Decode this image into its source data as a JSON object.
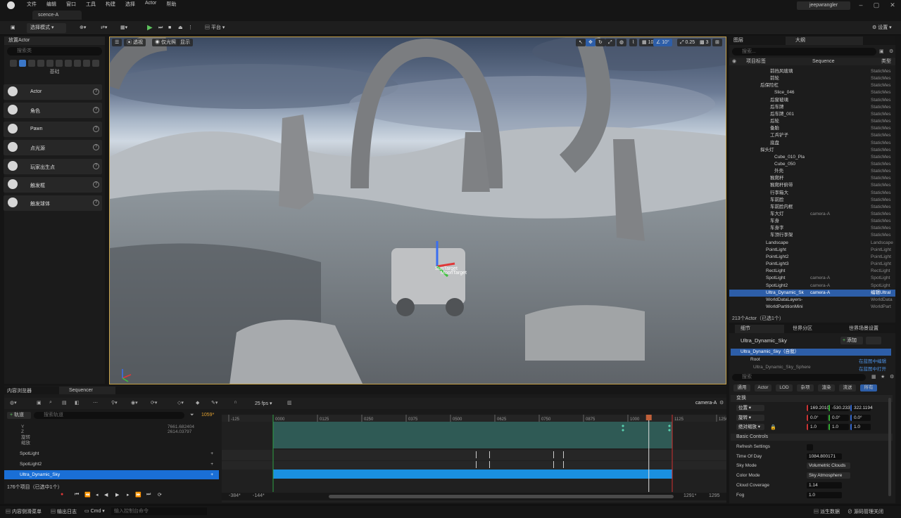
{
  "menu": [
    "文件",
    "编辑",
    "窗口",
    "工具",
    "构建",
    "选择",
    "Actor",
    "帮助"
  ],
  "scene_tab": "scence-A",
  "user": "jeepwrangler",
  "toolbar": {
    "select_mode": "选择模式",
    "platform": "平台",
    "settings": "设置"
  },
  "place": {
    "title": "放置Actor",
    "search_placeholder": "搜索类",
    "category": "基础",
    "items": [
      {
        "label": "Actor"
      },
      {
        "label": "角色"
      },
      {
        "label": "Pawn"
      },
      {
        "label": "点光源"
      },
      {
        "label": "玩家出生点"
      },
      {
        "label": "触发框"
      },
      {
        "label": "触发球体"
      }
    ]
  },
  "viewport": {
    "perspective": "透视",
    "lit": "仅光照",
    "show": "显示",
    "grid": "10",
    "angle": "10°",
    "scale": "0.25",
    "cam": "3",
    "labels": [
      "SunTarget",
      "MoonTarget"
    ]
  },
  "outliner": {
    "tab1": "图层",
    "tab2": "大纲",
    "search_placeholder": "搜索...",
    "col_label": "项目标签",
    "col_seq": "Sequence",
    "col_type": "类型",
    "rows": [
      {
        "name": "前挡风玻璃",
        "seq": "",
        "type": "StaticMes"
      },
      {
        "name": "前轮",
        "seq": "",
        "type": "StaticMes"
      },
      {
        "name": "后保险杠",
        "seq": "",
        "type": "StaticMes"
      },
      {
        "name": "Slice_046",
        "seq": "",
        "type": "StaticMes"
      },
      {
        "name": "后窗玻璃",
        "seq": "",
        "type": "StaticMes"
      },
      {
        "name": "后车牌",
        "seq": "",
        "type": "StaticMes"
      },
      {
        "name": "后车牌_001",
        "seq": "",
        "type": "StaticMes"
      },
      {
        "name": "后轮",
        "seq": "",
        "type": "StaticMes"
      },
      {
        "name": "备胎",
        "seq": "",
        "type": "StaticMes"
      },
      {
        "name": "工兵铲子",
        "seq": "",
        "type": "StaticMes"
      },
      {
        "name": "底盘",
        "seq": "",
        "type": "StaticMes"
      },
      {
        "name": "探头灯",
        "seq": "",
        "type": "StaticMes"
      },
      {
        "name": "Cube_010_Pla",
        "seq": "",
        "type": "StaticMes"
      },
      {
        "name": "Cube_050",
        "seq": "",
        "type": "StaticMes"
      },
      {
        "name": "外壳",
        "seq": "",
        "type": "StaticMes"
      },
      {
        "name": "猴爬杆",
        "seq": "",
        "type": "StaticMes"
      },
      {
        "name": "猴爬杆俯带",
        "seq": "",
        "type": "StaticMes"
      },
      {
        "name": "行李箱大",
        "seq": "",
        "type": "StaticMes"
      },
      {
        "name": "车前脸",
        "seq": "",
        "type": "StaticMes"
      },
      {
        "name": "车前脸内框",
        "seq": "",
        "type": "StaticMes"
      },
      {
        "name": "车大灯",
        "seq": "camera-A",
        "type": "StaticMes"
      },
      {
        "name": "车身",
        "seq": "",
        "type": "StaticMes"
      },
      {
        "name": "车身字",
        "seq": "",
        "type": "StaticMes"
      },
      {
        "name": "车顶行李架",
        "seq": "",
        "type": "StaticMes"
      },
      {
        "name": "Landscape",
        "seq": "",
        "type": "Landscape"
      },
      {
        "name": "PointLight",
        "seq": "",
        "type": "PointLight"
      },
      {
        "name": "PointLight2",
        "seq": "",
        "type": "PointLight"
      },
      {
        "name": "PointLight3",
        "seq": "",
        "type": "PointLight"
      },
      {
        "name": "RectLight",
        "seq": "",
        "type": "RectLight"
      },
      {
        "name": "SpotLight",
        "seq": "camera-A",
        "type": "SpotLight"
      },
      {
        "name": "SpotLight2",
        "seq": "camera-A",
        "type": "SpotLight"
      },
      {
        "name": "Ultra_Dynamic_Sk",
        "seq": "camera-A",
        "type": "编辑UltraI"
      },
      {
        "name": "WorldDataLayers-",
        "seq": "",
        "type": "WorldData"
      },
      {
        "name": "WorldPartitionMini",
        "seq": "",
        "type": "WorldPart"
      }
    ],
    "count": "213个Actor（已选1个）"
  },
  "details": {
    "tab1": "细节",
    "tab2": "世界分区",
    "tab3": "世界场景设置",
    "object": "Ultra_Dynamic_Sky",
    "add": "添加",
    "self": "Ultra_Dynamic_Sky（自我）",
    "root": "Root",
    "bp_edit": "在蓝图中编辑",
    "bp_open": "在蓝图中打开",
    "child": "Ultra_Dynamic_Sky_Sphere",
    "search_placeholder": "搜索",
    "filters": [
      "通用",
      "Actor",
      "LOD",
      "杂项",
      "渲染",
      "流送",
      "所有"
    ],
    "transform": "变换",
    "loc": "位置",
    "rot": "旋转",
    "scale": "绝对缩放",
    "loc_v": [
      "169.2010",
      "-530.233",
      "322.1194"
    ],
    "rot_v": [
      "0.0°",
      "0.0°",
      "0.0°"
    ],
    "scale_v": [
      "1.0",
      "1.0",
      "1.0"
    ],
    "basic": "Basic Controls",
    "props": [
      {
        "k": "Refresh Settings",
        "v": ""
      },
      {
        "k": "Time Of Day",
        "v": "1084.800171"
      },
      {
        "k": "Sky Mode",
        "v": "Volumetric Clouds"
      },
      {
        "k": "Color Mode",
        "v": "Sky Atmosphere"
      },
      {
        "k": "Cloud Coverage",
        "v": "1.14"
      },
      {
        "k": "Fog",
        "v": "1.0"
      }
    ]
  },
  "sequencer": {
    "tab1": "内容浏览器",
    "tab2": "Sequencer",
    "fps": "25 fps",
    "camera": "camera-A",
    "track": "轨道",
    "search_placeholder": "搜索轨道",
    "frame": "1059*",
    "rows": [
      {
        "label": "Y",
        "value": "7661.682404"
      },
      {
        "label": "Z",
        "value": "2614.03797"
      },
      {
        "label": "旋转",
        "value": ""
      },
      {
        "label": "缩放",
        "value": ""
      },
      {
        "label": "SpotLight",
        "value": ""
      },
      {
        "label": "SpotLight2",
        "value": ""
      },
      {
        "label": "Ultra_Dynamic_Sky",
        "value": ""
      }
    ],
    "count": "176个项目（已选中1个）",
    "ruler": [
      "-125",
      "0000",
      "0125",
      "0250",
      "0375",
      "0500",
      "0625",
      "0750",
      "0875",
      "1000",
      "1125",
      "1250"
    ],
    "playhead": "1059*",
    "range": [
      "-384*",
      "-144*",
      "1291*",
      "1295"
    ]
  },
  "status": {
    "drawer": "内容侧滑菜单",
    "log": "输出日志",
    "cmd": "Cmd",
    "cmd_placeholder": "输入控制台命令",
    "derived": "派生数据",
    "scm": "源码管理关闭"
  }
}
